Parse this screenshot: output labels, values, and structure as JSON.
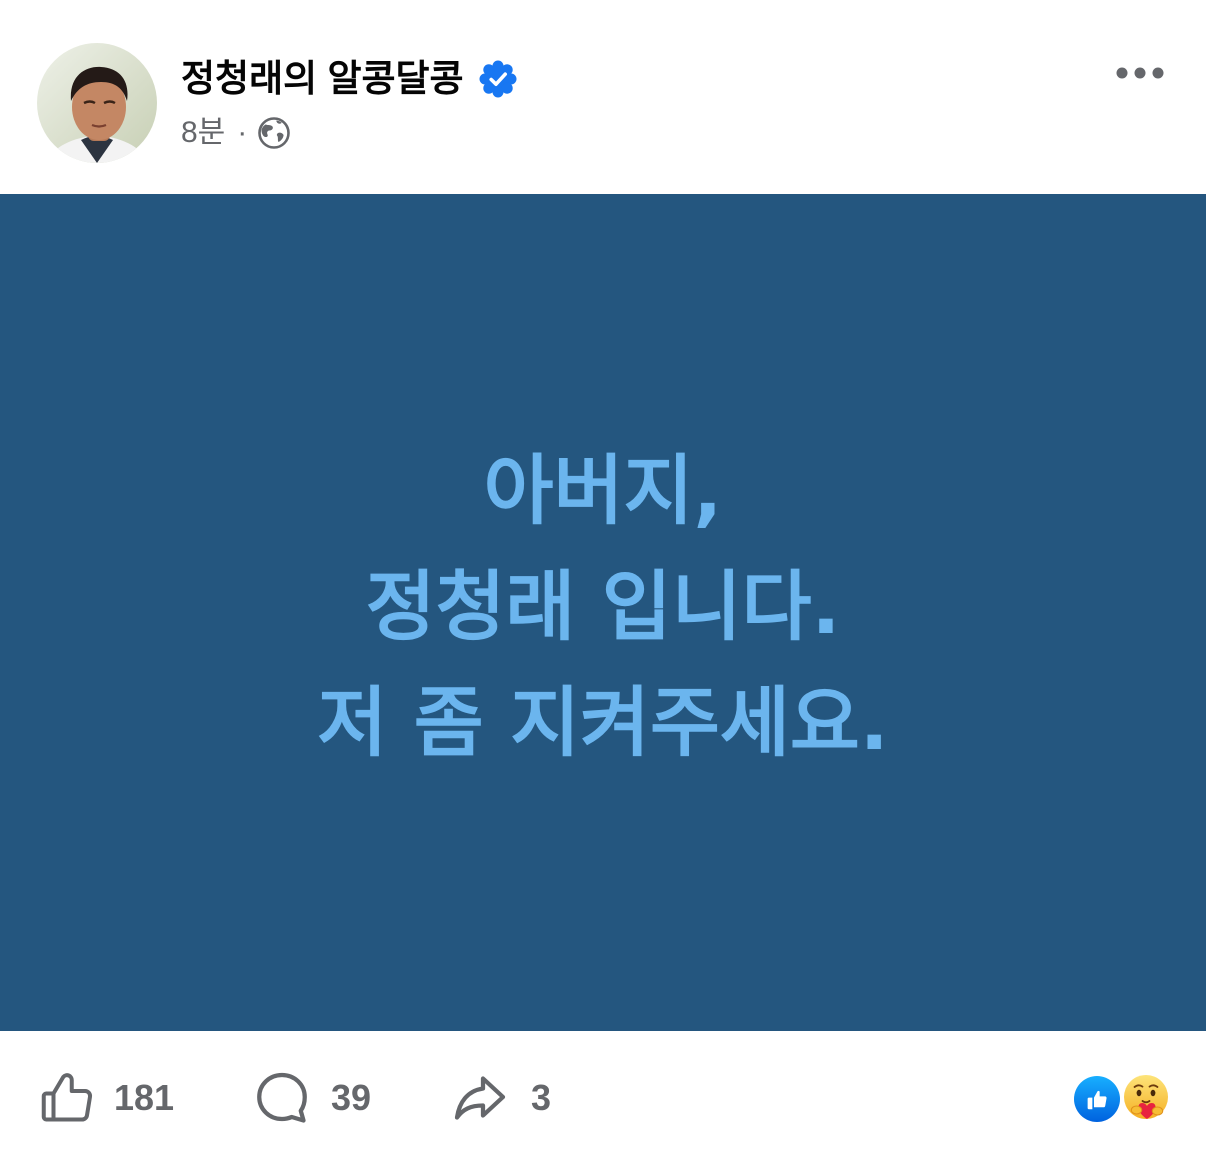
{
  "header": {
    "author_name": "정청래의 알콩달콩",
    "verified": true,
    "verified_icon": "verified-badge-icon",
    "timestamp": "8분",
    "separator": "·",
    "audience_icon": "globe-icon",
    "more_icon": "more-options-icon",
    "avatar_icon": "profile-photo"
  },
  "post": {
    "lines": [
      "아버지,",
      "정청래 입니다.",
      "저 좀 지켜주세요."
    ],
    "background_color": "#24567f",
    "text_color": "#6bb5ee"
  },
  "actions": {
    "like": {
      "icon": "thumbs-up-icon",
      "count": "181"
    },
    "comment": {
      "icon": "comment-bubble-icon",
      "count": "39"
    },
    "share": {
      "icon": "share-arrow-icon",
      "count": "3"
    },
    "reactions": [
      "like-reaction-icon",
      "care-reaction-icon"
    ]
  },
  "colors": {
    "accent": "#1877f2",
    "primary_text": "#050505",
    "secondary_text": "#65676b"
  }
}
